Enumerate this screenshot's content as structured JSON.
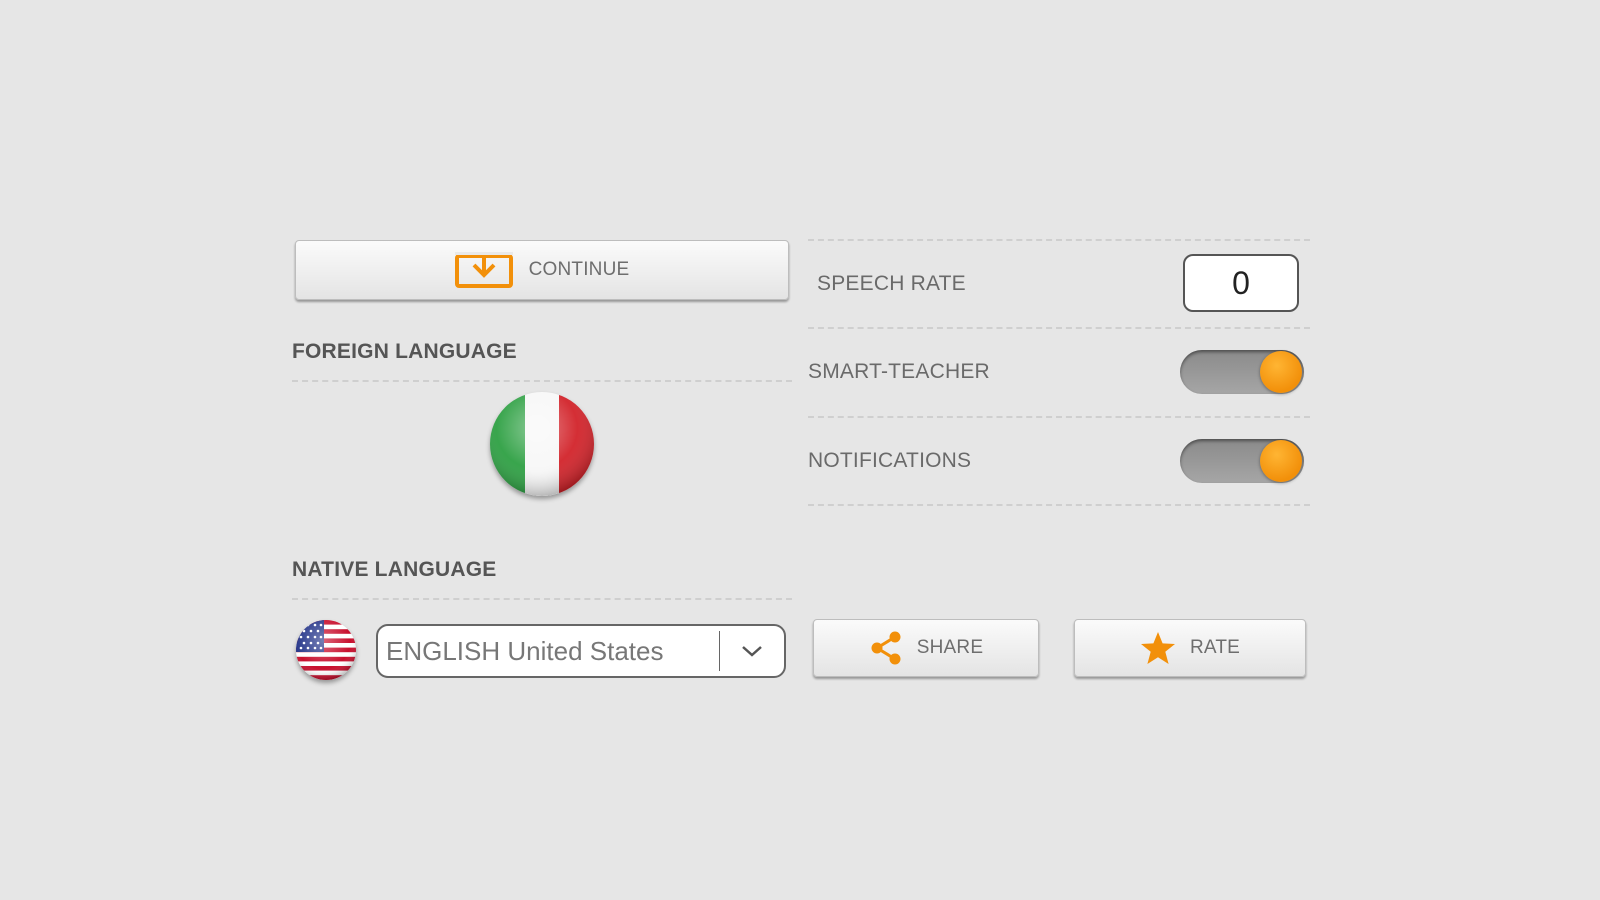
{
  "colors": {
    "background": "#e6e6e6",
    "accent": "#f2900a"
  },
  "continue_button": {
    "label": "CONTINUE",
    "icon": "download-tray-icon"
  },
  "foreign_language": {
    "heading": "FOREIGN LANGUAGE",
    "flag": "italy-flag"
  },
  "native_language": {
    "heading": "NATIVE LANGUAGE",
    "flag": "usa-flag",
    "selected": "ENGLISH United States"
  },
  "settings": {
    "speech_rate": {
      "label": "SPEECH RATE",
      "value": "0"
    },
    "smart_teacher": {
      "label": "SMART-TEACHER",
      "on": true
    },
    "notifications": {
      "label": "NOTIFICATIONS",
      "on": true
    }
  },
  "share_button": {
    "label": "SHARE",
    "icon": "share-icon"
  },
  "rate_button": {
    "label": "RATE",
    "icon": "star-icon"
  }
}
